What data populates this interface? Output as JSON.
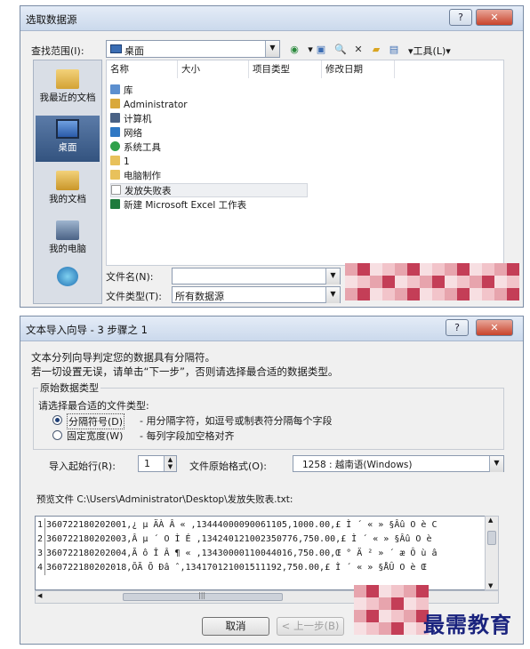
{
  "open_dialog": {
    "title": "选取数据源",
    "look_in_label": "查找范围(I):",
    "look_in_value": "桌面",
    "tools_label": "▾工具(L)▾",
    "places": [
      {
        "label": "我最近的文档"
      },
      {
        "label": "桌面"
      },
      {
        "label": "我的文档"
      },
      {
        "label": "我的电脑"
      },
      {
        "label": ""
      }
    ],
    "columns": [
      "名称",
      "大小",
      "项目类型",
      "修改日期"
    ],
    "files": [
      {
        "name": "库"
      },
      {
        "name": "Administrator"
      },
      {
        "name": "计算机"
      },
      {
        "name": "网络"
      },
      {
        "name": "系统工具"
      },
      {
        "name": "1"
      },
      {
        "name": "电脑制作"
      },
      {
        "name": "发放失败表"
      },
      {
        "name": "新建 Microsoft Excel 工作表"
      }
    ],
    "filename_label": "文件名(N):",
    "filename_value": "",
    "filetype_label": "文件类型(T):",
    "filetype_value": "所有数据源"
  },
  "wizard": {
    "title": "文本导入向导 - 3 步骤之 1",
    "intro_line1": "文本分列向导判定您的数据具有分隔符。",
    "intro_line2": "若一切设置无误，请单击“下一步”，否则请选择最合适的数据类型。",
    "group_title": "原始数据类型",
    "choose_label": "请选择最合适的文件类型:",
    "option_delimited": "分隔符号(D)",
    "option_delimited_desc": "- 用分隔字符，如逗号或制表符分隔每个字段",
    "option_fixed": "固定宽度(W)",
    "option_fixed_desc": "- 每列字段加空格对齐",
    "start_row_label": "导入起始行(R):",
    "start_row_value": "1",
    "origin_label": "文件原始格式(O):",
    "origin_value": "1258 : 越南语(Windows)",
    "preview_label": "预览文件 C:\\Users\\Administrator\\Desktop\\发放失败表.txt:",
    "preview_rows": [
      {
        "num": "1",
        "text": "360722180202001,¿ µ ÄÀ Â « ,13444000090061105,1000.00,£ Ì ´ « » §Âû O è C"
      },
      {
        "num": "2",
        "text": "360722180202003,Â µ ´ O Ì É ,134240121002350776,750.00,£ Ì ´ « » §Âû O è"
      },
      {
        "num": "3",
        "text": "360722180202004,Ã ô Î Â ¶ « ,13430000110044016,750.00,Œ ° Ä ² » ´ æ Ô ù â"
      },
      {
        "num": "4",
        "text": "360722180202018,ÕÃ Õ Ðâ ˆ,134170121001511192,750.00,£ Ì ´ « » §ÅÛ O è Œ"
      }
    ],
    "cancel_label": "取消",
    "back_label": "< 上一步(B)"
  },
  "watermark": {
    "brand": "最需教育"
  },
  "colors": {
    "accent": "#1f3f77",
    "close_button": "#c8432b",
    "brand": "#1a237e"
  }
}
